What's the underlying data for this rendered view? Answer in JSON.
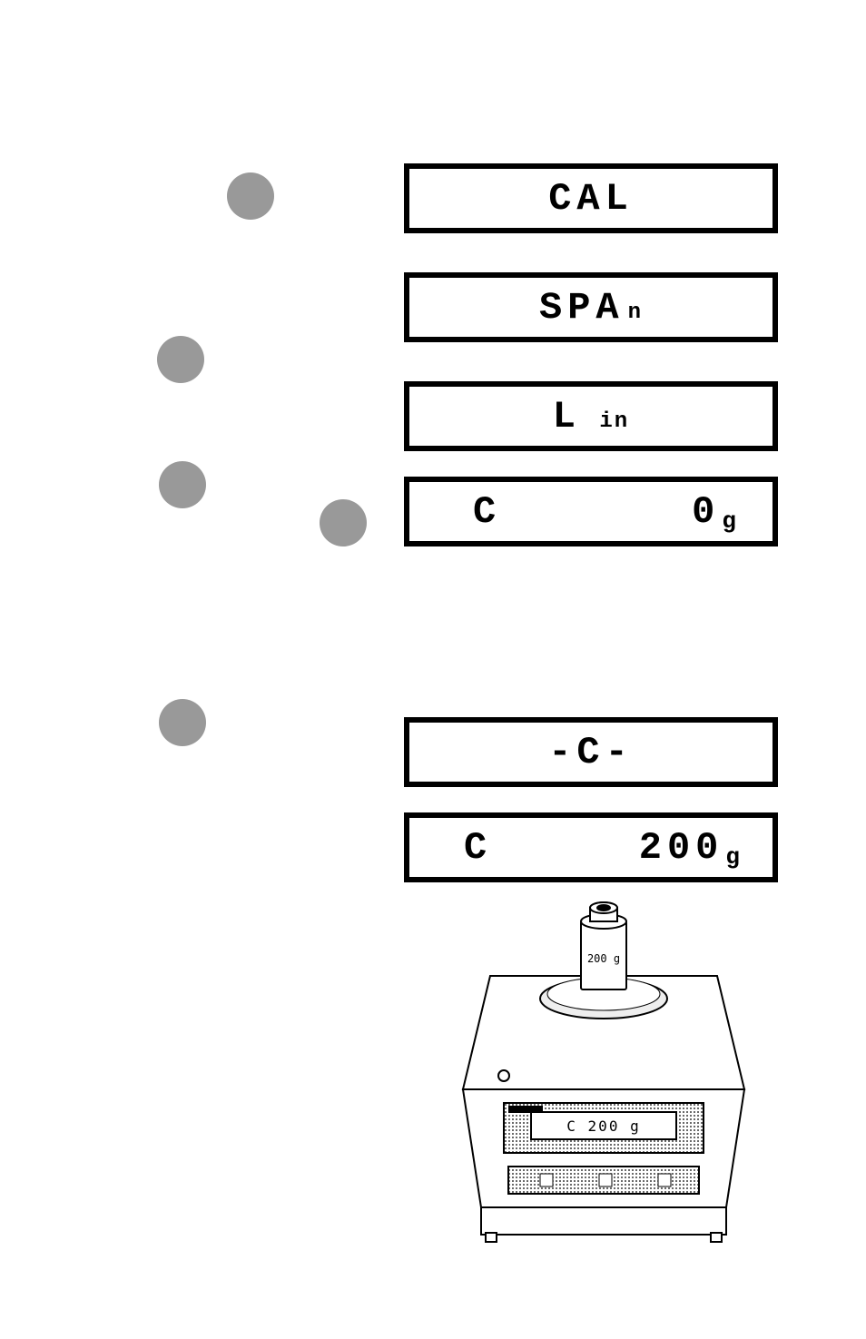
{
  "displays": {
    "d1": "CAL",
    "d2_main": "SPA",
    "d2_sub": "n",
    "d3_main": "L",
    "d3_sub": " in",
    "d4_left": "C",
    "d4_right": "0",
    "d4_unit": "g",
    "d5": "-C-",
    "d6_left": "C",
    "d6_right": "200",
    "d6_unit": "g",
    "weight_label": "200 g",
    "mini_display": "C   200 g"
  }
}
